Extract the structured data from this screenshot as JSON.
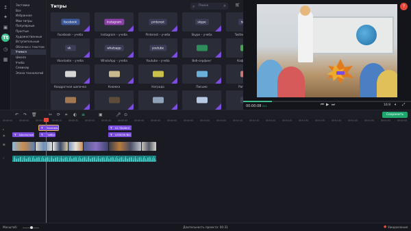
{
  "rail": {
    "items": [
      {
        "icon": "import-icon",
        "glyph": "↥"
      },
      {
        "icon": "magic-wand-icon",
        "glyph": "✦"
      },
      {
        "icon": "filters-icon",
        "glyph": "▣"
      },
      {
        "icon": "titles-icon",
        "glyph": "Tt"
      },
      {
        "icon": "clock-icon",
        "glyph": "◷"
      },
      {
        "icon": "grid-icon",
        "glyph": "▦"
      }
    ]
  },
  "categories": [
    "Заставки",
    "Все",
    "Избранное",
    "Мои титры",
    "Популярные",
    "Простые",
    "Художественные",
    "Вступительные",
    "Облачка с текстом",
    "Учимся",
    "Школа",
    "Учеба",
    "Семинар",
    "Эпоха технологий"
  ],
  "selected_category": "Учимся",
  "panel": {
    "title": "Титры",
    "search_placeholder": "Поиск"
  },
  "cards": [
    {
      "caption": "Facebook – учеба",
      "inner": "facebook",
      "color": "#3b5998"
    },
    {
      "caption": "Instagram – учеба",
      "inner": "instagram",
      "color": "#8d3fa8"
    },
    {
      "caption": "Pinterest – учеба",
      "inner": "pinterest",
      "color": "#3a3d55"
    },
    {
      "caption": "Skype – учеба",
      "inner": "skype",
      "color": "#3a3d55"
    },
    {
      "caption": "Twitter – учеба",
      "inner": "twitter",
      "color": "#3a3d55"
    },
    {
      "caption": "Vkontakte – учеба",
      "inner": "vk",
      "color": "#3a3d55"
    },
    {
      "caption": "WhatsApp – учеба",
      "inner": "whatsapp",
      "color": "#3a3d55"
    },
    {
      "caption": "Youtube – учеба",
      "inner": "youtube",
      "color": "#3a3d55"
    },
    {
      "caption": "Веб-серфинг",
      "inner": "",
      "color": "#2f8c5b"
    },
    {
      "caption": "Кафетерий",
      "inner": "",
      "color": "#4aa35a"
    },
    {
      "caption": "Квадратная шапочка",
      "inner": "",
      "color": "#d6d6d6"
    },
    {
      "caption": "Книжка",
      "inner": "",
      "color": "#c8b98f"
    },
    {
      "caption": "Награда",
      "inner": "",
      "color": "#c9c04a"
    },
    {
      "caption": "Письмо",
      "inner": "",
      "color": "#6ab0d8"
    },
    {
      "caption": "Раговоры",
      "inner": "",
      "color": "#c27a7a"
    },
    {
      "caption": "",
      "inner": "",
      "color": "#a27850"
    },
    {
      "caption": "",
      "inner": "",
      "color": "#5d4c3a"
    },
    {
      "caption": "",
      "inner": "",
      "color": "#8fa2b8"
    },
    {
      "caption": "",
      "inner": "",
      "color": "#b7c8e5"
    },
    {
      "caption": "",
      "inner": "",
      "color": "#3c3f52"
    }
  ],
  "preview": {
    "time": "00:00:08",
    "time_ms": "011",
    "progress": 0.17,
    "ratio": "16:9"
  },
  "toolbar": {
    "save_label": "Сохранить"
  },
  "ruler": [
    "00:00:00",
    "00:00:05",
    "00:00:10",
    "00:00:15",
    "00:00:20",
    "00:00:25",
    "00:00:30",
    "00:00:35",
    "00:00:40",
    "00:00:45",
    "00:00:50",
    "00:00:55",
    "00:01:00",
    "00:01:05",
    "00:01:10",
    "00:01:15",
    "00:01:20",
    "00:01:25",
    "00:01:30",
    "00:01:35",
    "00:01:40",
    "00:01:45",
    "00:01:50",
    "00:01:55",
    "00:02:00"
  ],
  "clips": {
    "t1": "Школьные з",
    "t2": "Осознаю",
    "t3": "Глобус",
    "t4": "A1 Student",
    "t5": "LESSON №2"
  },
  "footer": {
    "zoom_label": "Масштаб:",
    "duration": "Длительность проекта: 00:31",
    "notifications": "Уведомления"
  }
}
